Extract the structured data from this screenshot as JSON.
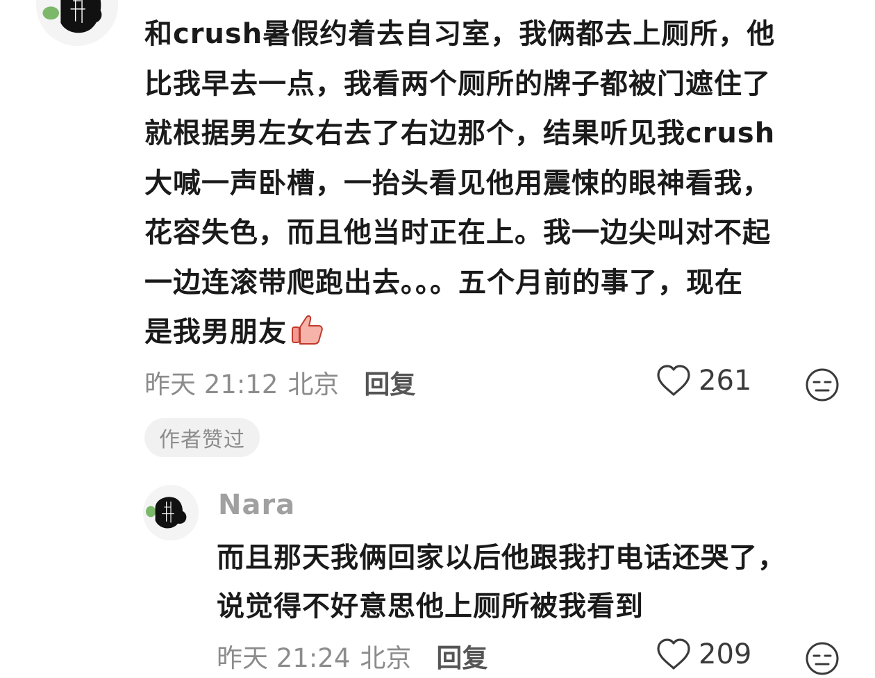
{
  "main_comment": {
    "lines": [
      "和crush暑假约着去自习室，我俩都去上厕所，他",
      "比我早去一点，我看两个厕所的牌子都被门遮住了",
      "就根据男左女右去了右边那个，结果听见我crush",
      "大喊一声卧槽，一抬头看见他用震悚的眼神看我，",
      "花容失色，而且他当时正在上。我一边尖叫对不起",
      "一边连滚带爬跑出去。。。五个月前的事了，现在",
      "是我男朋友"
    ],
    "emoji": "thumbs-up-icon",
    "timestamp": "昨天 21:12",
    "location": "北京",
    "reply_label": "回复",
    "like_count": "261",
    "author_badge": "作者赞过"
  },
  "reply_comment": {
    "username": "Nara",
    "lines": [
      "而且那天我俩回家以后他跟我打电话还哭了，",
      "说觉得不好意思他上厕所被我看到"
    ],
    "timestamp": "昨天 21:24",
    "location": "北京",
    "reply_label": "回复",
    "like_count": "209"
  },
  "colors": {
    "text": "#1a1a1a",
    "meta": "#8c8c8c",
    "badge_bg": "#f1f1f1",
    "username": "#a0a0a0"
  }
}
